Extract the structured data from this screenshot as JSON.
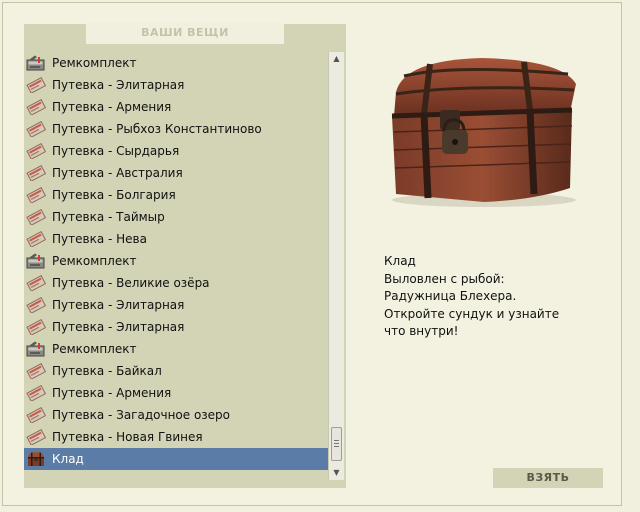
{
  "inventory": {
    "header": "ВАШИ ВЕЩИ",
    "items": [
      {
        "label": "Ремкомплект",
        "icon": "repair-kit-icon"
      },
      {
        "label": "Путевка - Элитарная",
        "icon": "voucher-icon"
      },
      {
        "label": "Путевка - Армения",
        "icon": "voucher-icon"
      },
      {
        "label": "Путевка - Рыбхоз Константиново",
        "icon": "voucher-icon"
      },
      {
        "label": "Путевка - Сырдарья",
        "icon": "voucher-icon"
      },
      {
        "label": "Путевка - Австралия",
        "icon": "voucher-icon"
      },
      {
        "label": "Путевка - Болгария",
        "icon": "voucher-icon"
      },
      {
        "label": "Путевка - Таймыр",
        "icon": "voucher-icon"
      },
      {
        "label": "Путевка - Нева",
        "icon": "voucher-icon"
      },
      {
        "label": "Ремкомплект",
        "icon": "repair-kit-icon"
      },
      {
        "label": "Путевка - Великие озёра",
        "icon": "voucher-icon"
      },
      {
        "label": "Путевка - Элитарная",
        "icon": "voucher-icon"
      },
      {
        "label": "Путевка - Элитарная",
        "icon": "voucher-icon"
      },
      {
        "label": "Ремкомплект",
        "icon": "repair-kit-icon"
      },
      {
        "label": "Путевка - Байкал",
        "icon": "voucher-icon"
      },
      {
        "label": "Путевка - Армения",
        "icon": "voucher-icon"
      },
      {
        "label": "Путевка - Загадочное озеро",
        "icon": "voucher-icon"
      },
      {
        "label": "Путевка - Новая Гвинея",
        "icon": "voucher-icon"
      },
      {
        "label": "Клад",
        "icon": "treasure-chest-icon"
      }
    ],
    "selected_index": 18
  },
  "detail": {
    "image_icon": "treasure-chest-icon",
    "lines": [
      "Клад",
      "Выловлен с рыбой:",
      "Радужница Блехера.",
      "Откройте сундук и узнайте",
      "что внутри!"
    ]
  },
  "take_button": "ВЗЯТЬ",
  "colors": {
    "page_bg": "#f1f0de",
    "panel_bg": "#d3d3b6",
    "selected_row": "#5a7ca6",
    "header_text": "#c4c3aa"
  }
}
